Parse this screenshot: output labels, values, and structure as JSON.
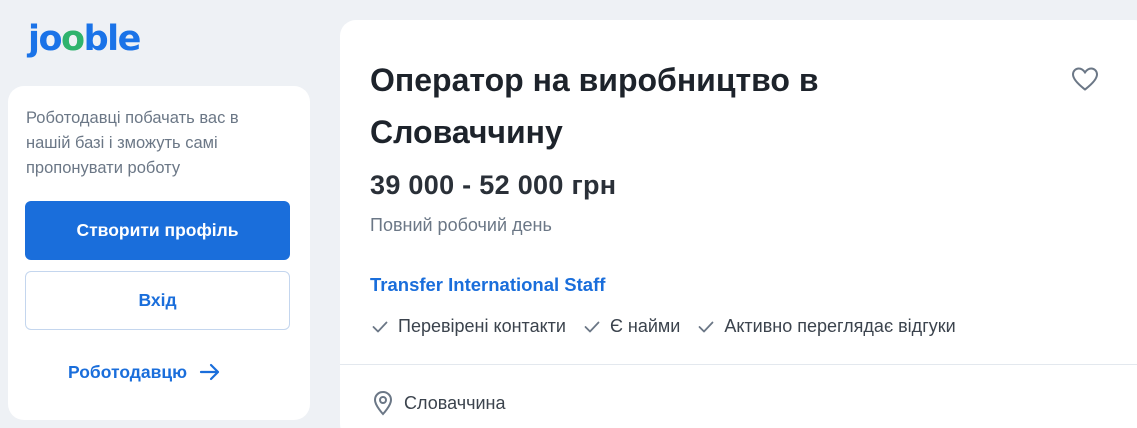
{
  "brand": {
    "logo_text": "jooble",
    "accent": "#1a6edb",
    "logo_accent": "#2fb36d"
  },
  "sidebar": {
    "promo_text": "Роботодавці побачать вас в нашій базі і зможуть самі пропонувати роботу",
    "create_profile_label": "Створити профіль",
    "login_label": "Вхід",
    "employer_link_label": "Роботодавцю",
    "employer_link_icon": "arrow-right-icon"
  },
  "job": {
    "title": "Оператор на виробництво в Словаччину",
    "salary": "39 000 - 52 000 грн",
    "schedule": "Повний робочий день",
    "company": "Transfer International Staff",
    "badges": [
      "Перевірені контакти",
      "Є найми",
      "Активно переглядає відгуки"
    ],
    "location": "Словаччина",
    "favorite_icon": "heart-icon",
    "badge_icon": "check-icon",
    "location_icon": "map-pin-icon"
  }
}
